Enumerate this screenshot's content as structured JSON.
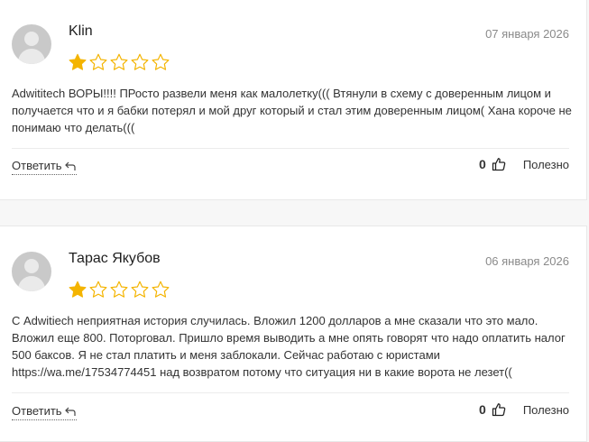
{
  "colors": {
    "star_filled": "#f4b400",
    "star_empty": "#f4b400"
  },
  "reviews": [
    {
      "author": "Klin",
      "date": "07 января 2026",
      "rating": 1,
      "max_rating": 5,
      "text": "Adwititech ВОРЫ!!!! ПРосто развели меня как малолетку((( Втянули в схему с доверенным лицом и получается что и я бабки потерял и мой друг который и стал этим доверенным лицом( Хана короче не понимаю что делать(((",
      "reply_label": "Ответить",
      "likes": "0",
      "useful_label": "Полезно"
    },
    {
      "author": "Тарас Якубов",
      "date": "06 января 2026",
      "rating": 1,
      "max_rating": 5,
      "text_before": "С Adwitiech неприятная история случилась. Вложил 1200 долларов а мне сказали что это мало. Вложил еще 800. Поторговал. Пришло время выводить а мне опять говорят что надо оплатить налог 500 баксов. Я не стал платить и меня заблокали. Сейчас работаю с юристами ",
      "link": "https://wa.me/17534774451",
      "text_after": " над возвратом потому что ситуация ни в какие ворота не лезет((",
      "reply_label": "Ответить",
      "likes": "0",
      "useful_label": "Полезно"
    }
  ],
  "icons": {
    "avatar": "user-avatar-placeholder",
    "star_filled": "star-filled-icon",
    "star_empty": "star-outline-icon",
    "reply": "reply-arrow-icon",
    "like": "thumbs-up-icon"
  }
}
